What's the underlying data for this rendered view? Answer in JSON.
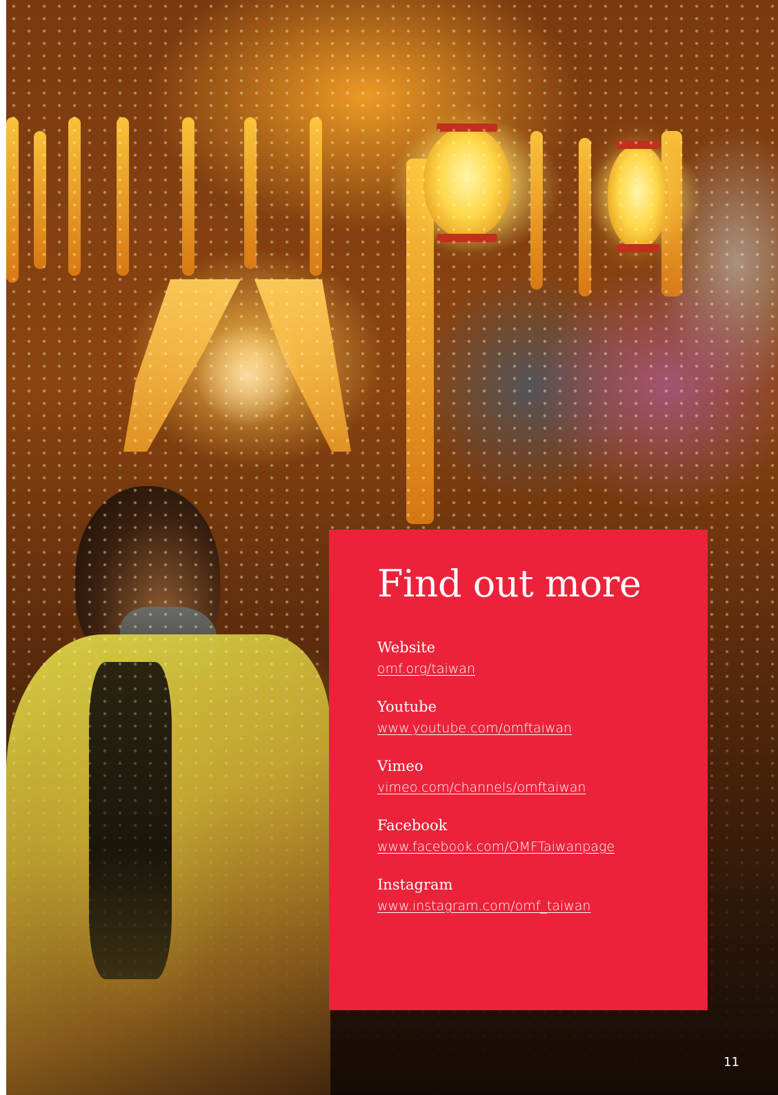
{
  "info_box": {
    "title": "Find out more",
    "links": [
      {
        "label": "Website",
        "url": "omf.org/taiwan"
      },
      {
        "label": "Youtube",
        "url": "www.youtube.com/omftaiwan"
      },
      {
        "label": "Vimeo",
        "url": "vimeo.com/channels/omftaiwan"
      },
      {
        "label": "Facebook",
        "url": "www.facebook.com/OMFTaiwanpage"
      },
      {
        "label": "Instagram",
        "url": "www.instagram.com/omf_taiwan"
      }
    ]
  },
  "page_number": "11",
  "colors": {
    "box_background": "#ec223a",
    "text": "#ffffff"
  }
}
